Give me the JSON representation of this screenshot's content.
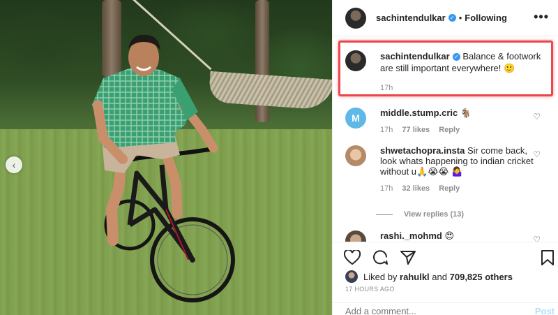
{
  "post_header": {
    "username": "sachintendulkar",
    "separator": "•",
    "follow_status": "Following",
    "more_label": "•••"
  },
  "caption": {
    "username": "sachintendulkar",
    "text": "Balance & footwork are still important everywhere! 🙂",
    "time": "17h"
  },
  "comments": [
    {
      "username": "middle.stump.cric",
      "text": "🐐",
      "time": "17h",
      "likes": "77 likes",
      "reply": "Reply",
      "avatar_letter": "M"
    },
    {
      "username": "shwetachopra.insta",
      "text": "Sir come back, look whats happening to indian cricket without u🙏😭😭 🤷‍♀️",
      "time": "17h",
      "likes": "32 likes",
      "reply": "Reply"
    },
    {
      "username": "rashi._mohmd",
      "text": "😍"
    }
  ],
  "view_replies": "View replies (13)",
  "likes_summary": {
    "prefix": "Liked by",
    "user": "rahulkl",
    "middle": "and",
    "count": "709,825 others"
  },
  "timestamp": "17 HOURS AGO",
  "add_comment": {
    "placeholder": "Add a comment...",
    "post_label": "Post"
  },
  "photo": {
    "nav_arrow": "‹"
  },
  "colors": {
    "highlight": "#e8474b",
    "verified": "#3897f0",
    "meta": "#8e8e8e",
    "post_disabled": "#b2dffc"
  }
}
